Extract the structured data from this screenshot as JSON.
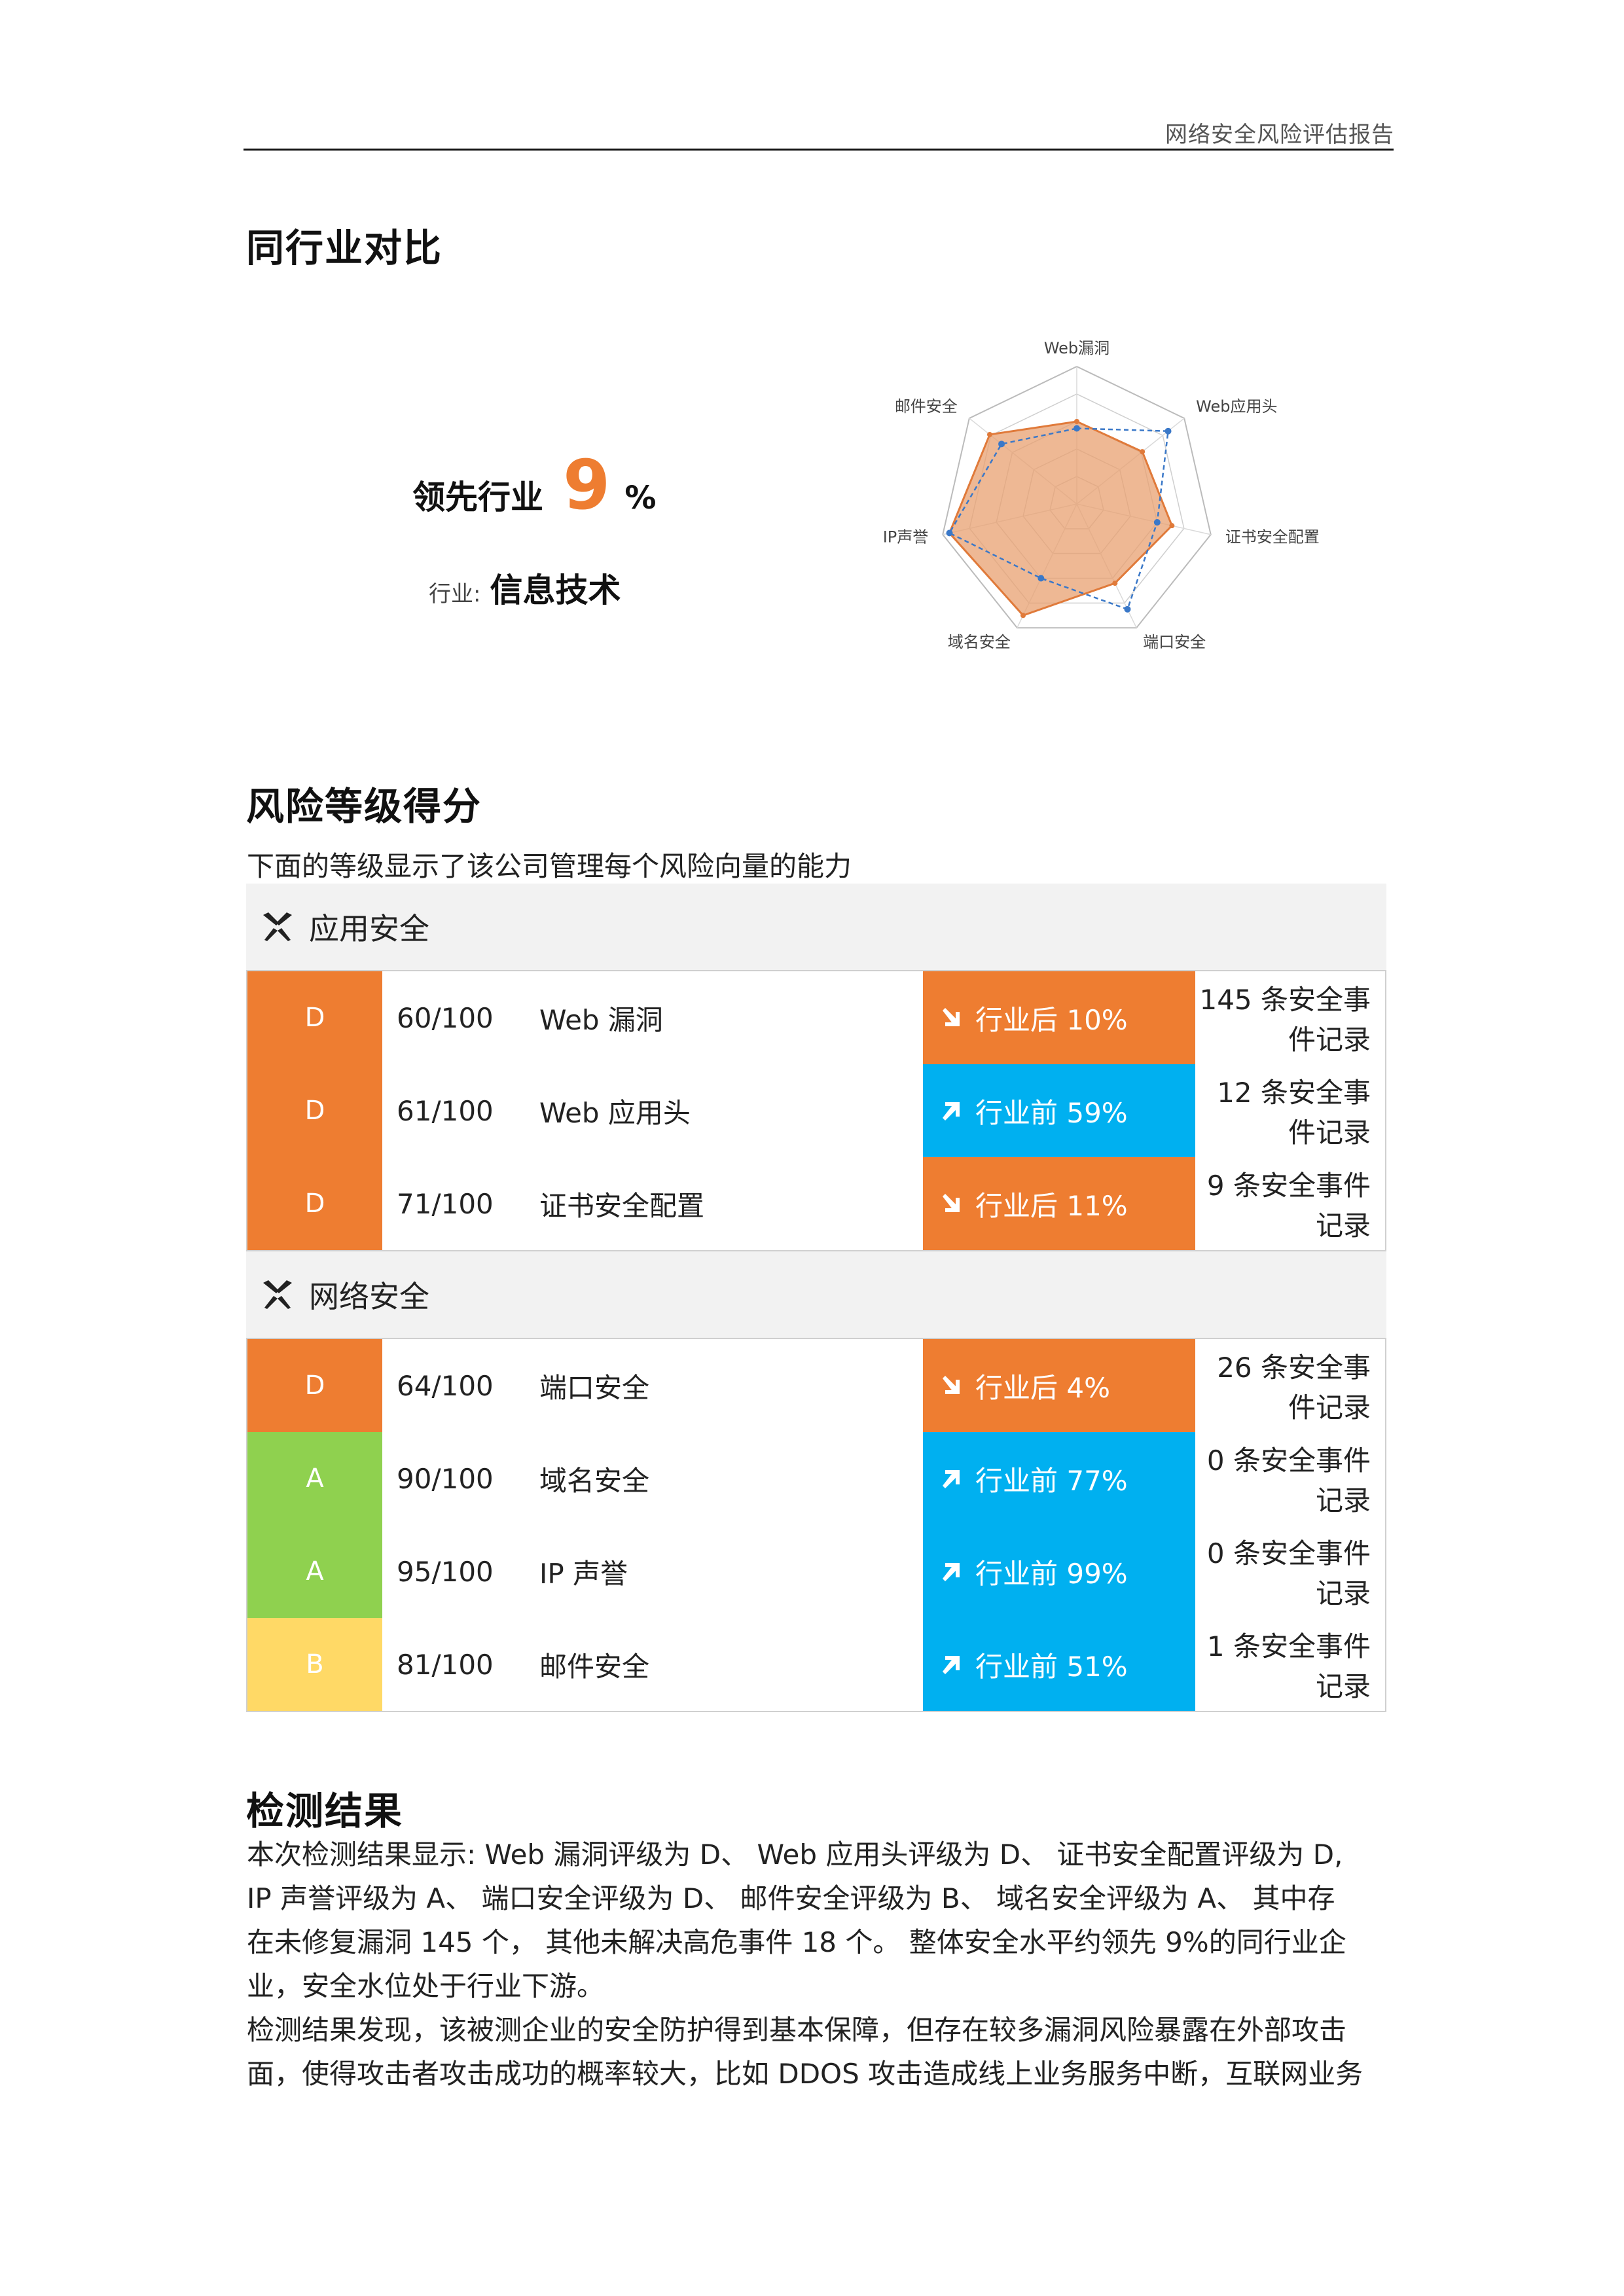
{
  "header": {
    "title": "网络安全风险评估报告"
  },
  "comparison": {
    "heading": "同行业对比",
    "lead_label": "领先行业",
    "lead_value": "9",
    "lead_unit": "%",
    "industry_label": "行业:",
    "industry_value": "信息技术"
  },
  "chart_data": {
    "type": "radar",
    "axes": [
      "Web漏洞",
      "Web应用头",
      "证书安全配置",
      "端口安全",
      "域名安全",
      "IP声誉",
      "邮件安全"
    ],
    "range": [
      0,
      100
    ],
    "grid": true,
    "series": [
      {
        "values": [
          60,
          61,
          71,
          64,
          90,
          95,
          81
        ],
        "color": "#E8A070",
        "style": "filled"
      },
      {
        "values": [
          55,
          85,
          60,
          85,
          60,
          95,
          70
        ],
        "color": "#3A78C8",
        "style": "dashed"
      }
    ]
  },
  "risk": {
    "heading": "风险等级得分",
    "subtitle": "下面的等级显示了该公司管理每个风险向量的能力",
    "colors": {
      "D": "#EE7D31",
      "A": "#8FD14F",
      "B": "#FFD966",
      "up": "#00B0F0",
      "down": "#EE7D31"
    },
    "groups": [
      {
        "title": "应用安全",
        "icon": "tools-icon",
        "rows": [
          {
            "grade": "D",
            "score": "60/100",
            "item": "Web 漏洞",
            "trend": "down",
            "trend_text": "行业后 10%",
            "events": "145 条安全事件记录"
          },
          {
            "grade": "D",
            "score": "61/100",
            "item": "Web 应用头",
            "trend": "up",
            "trend_text": "行业前 59%",
            "events": "12 条安全事件记录"
          },
          {
            "grade": "D",
            "score": "71/100",
            "item": "证书安全配置",
            "trend": "down",
            "trend_text": "行业后 11%",
            "events": "9 条安全事件记录"
          }
        ]
      },
      {
        "title": "网络安全",
        "icon": "tools-icon",
        "rows": [
          {
            "grade": "D",
            "score": "64/100",
            "item": "端口安全",
            "trend": "down",
            "trend_text": "行业后 4%",
            "events": "26 条安全事件记录"
          },
          {
            "grade": "A",
            "score": "90/100",
            "item": "域名安全",
            "trend": "up",
            "trend_text": "行业前 77%",
            "events": "0 条安全事件记录"
          },
          {
            "grade": "A",
            "score": "95/100",
            "item": "IP 声誉",
            "trend": "up",
            "trend_text": "行业前 99%",
            "events": "0 条安全事件记录"
          },
          {
            "grade": "B",
            "score": "81/100",
            "item": "邮件安全",
            "trend": "up",
            "trend_text": "行业前 51%",
            "events": "1 条安全事件记录"
          }
        ]
      }
    ]
  },
  "results": {
    "heading": "检测结果",
    "paragraph1_lines": [
      "本次检测结果显示: Web 漏洞评级为 D、 Web 应用头评级为 D、 证书安全配置评级为 D,",
      "IP 声誉评级为 A、 端口安全评级为 D、 邮件安全评级为 B、 域名安全评级为 A、 其中存",
      "在未修复漏洞 145 个， 其他未解决高危事件 18 个。 整体安全水平约领先 9%的同行业企",
      "业，安全水位处于行业下游。"
    ],
    "paragraph2_lines": [
      "检测结果发现，该被测企业的安全防护得到基本保障，但存在较多漏洞风险暴露在外部攻击",
      "面，使得攻击者攻击成功的概率较大，比如 DDOS 攻击造成线上业务服务中断，互联网业务"
    ]
  }
}
